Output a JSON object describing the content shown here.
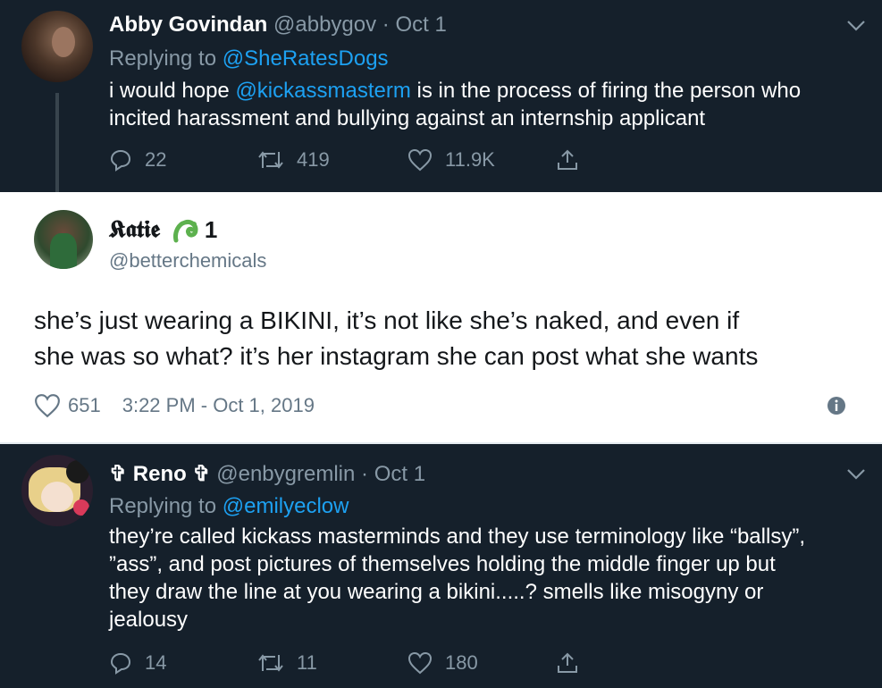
{
  "tweet1": {
    "display_name": "Abby Govindan",
    "handle": "@abbygov",
    "sep": "·",
    "date": "Oct 1",
    "replying_prefix": "Replying to",
    "replying_to": "@SheRatesDogs",
    "body_pre": "i would hope ",
    "body_mention": "@kickassmasterm",
    "body_line1_post": " is in the process of firing the person who",
    "body_line2": "incited harassment and bullying against an internship applicant",
    "replies": "22",
    "retweets": "419",
    "likes": "11.9K"
  },
  "tweet2": {
    "display_name": "𝕶𝖆𝖙𝖎𝖊",
    "badge_text": "1",
    "handle": "@betterchemicals",
    "body_line1": "she’s just wearing a BIKINI, it’s not like she’s naked, and even if",
    "body_line2": "she was so what? it’s her instagram she can post what she wants",
    "likes": "651",
    "timestamp": "3:22 PM - Oct 1, 2019"
  },
  "tweet3": {
    "display_name": "✞ Reno ✞",
    "handle": "@enbygremlin",
    "sep": "·",
    "date": "Oct 1",
    "replying_prefix": "Replying to",
    "replying_to": "@emilyeclow",
    "body_line1": "they’re called kickass masterminds and they use terminology like “ballsy”,",
    "body_line2": "”ass”, and post pictures of themselves holding the middle finger up but",
    "body_line3": "they draw the line at you wearing a bikini.....? smells like misogyny or",
    "body_line4": "jealousy",
    "replies": "14",
    "retweets": "11",
    "likes": "180"
  },
  "colors": {
    "dark_bg": "#15202b",
    "muted": "#8899a6",
    "link": "#1da1f2",
    "light_bg": "#ffffff"
  },
  "icons": [
    "reply-icon",
    "retweet-icon",
    "like-icon",
    "share-icon",
    "chevron-down-icon",
    "info-icon",
    "heart-outline-icon"
  ]
}
